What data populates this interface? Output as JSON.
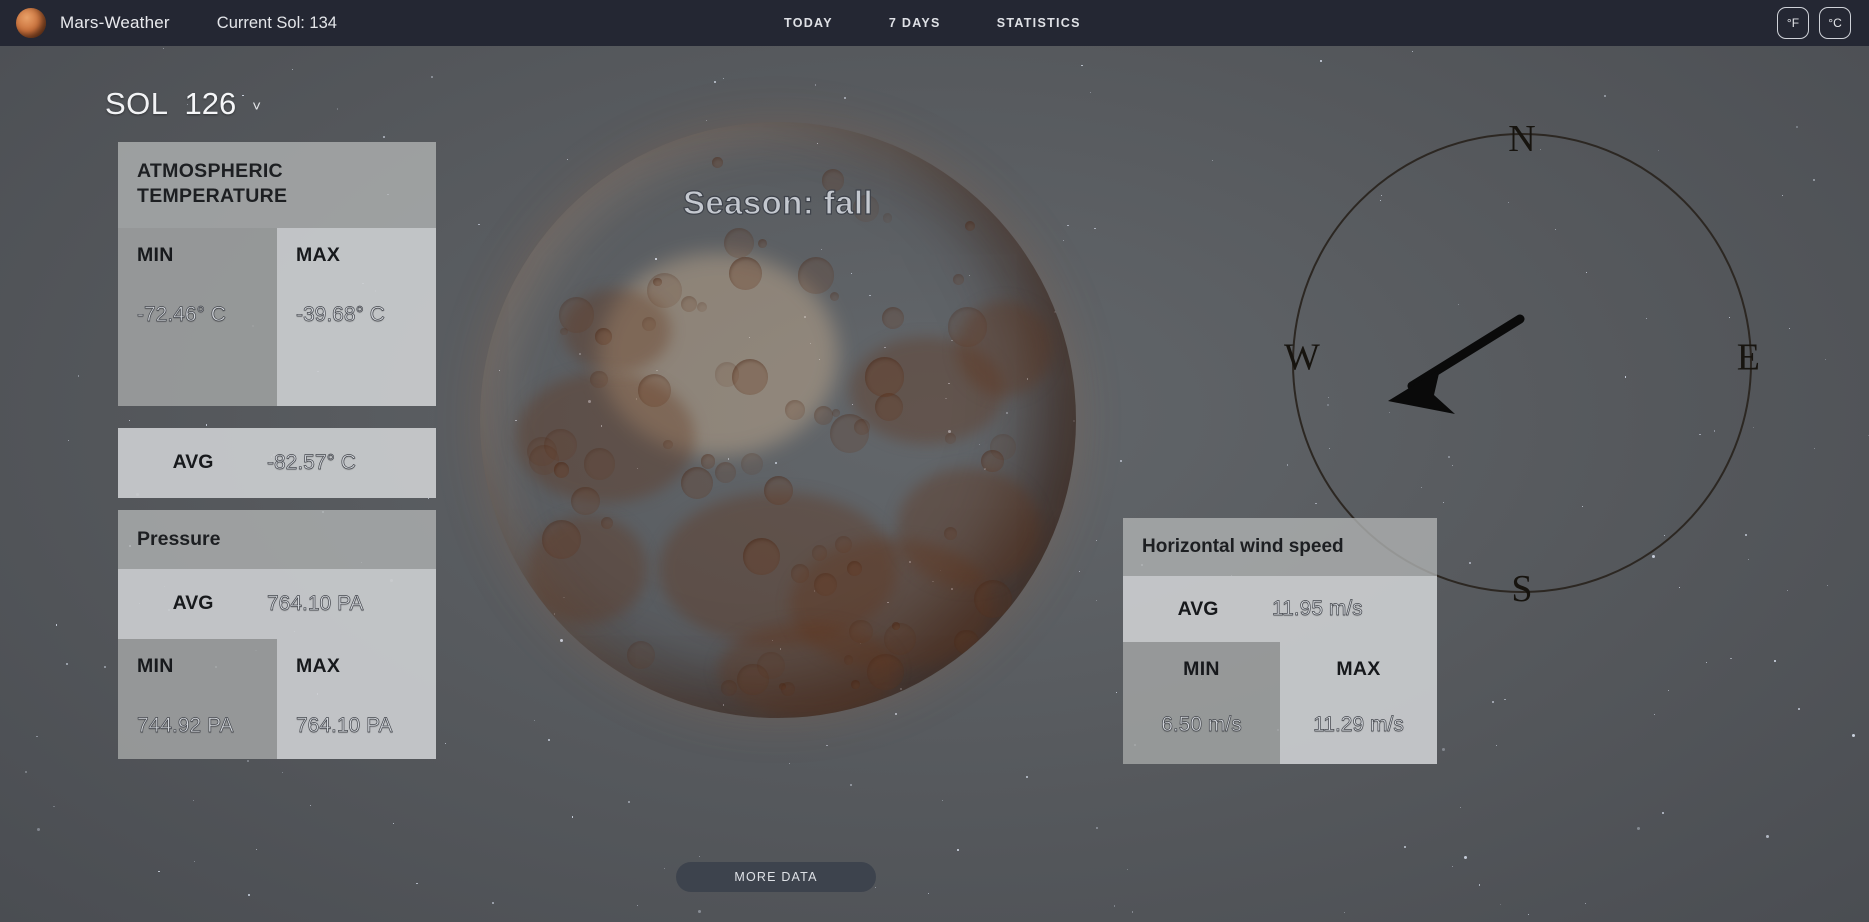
{
  "header": {
    "brand_name": "Mars-Weather",
    "brand_logo_icon": "mars-planet-icon",
    "current_sol": "Current Sol: 134",
    "nav": [
      {
        "label": "TODAY"
      },
      {
        "label": "7 DAYS"
      },
      {
        "label": "STATISTICS"
      }
    ],
    "units": [
      {
        "label": "°F"
      },
      {
        "label": "°C"
      }
    ]
  },
  "sol_selector": {
    "label": "SOL",
    "value": "126",
    "caret_icon": "chevron-down-icon"
  },
  "temperature_card": {
    "title": "ATMOSPHERIC TEMPERATURE",
    "min_label": "MIN",
    "min_value": "-72.46° C",
    "max_label": "MAX",
    "max_value": "-39.68° C",
    "avg_label": "AVG",
    "avg_value": "-82.57° C"
  },
  "pressure_card": {
    "title": "Pressure",
    "avg_label": "AVG",
    "avg_value": "764.10 PA",
    "min_label": "MIN",
    "min_value": "744.92 PA",
    "max_label": "MAX",
    "max_value": "764.10 PA"
  },
  "wind_card": {
    "title": "Horizontal wind speed",
    "avg_label": "AVG",
    "avg_value": "11.95 m/s",
    "min_label": "MIN",
    "min_value": "6.50 m/s",
    "max_label": "MAX",
    "max_value": "11.29 m/s"
  },
  "compass": {
    "north": "N",
    "east": "E",
    "south": "S",
    "west": "W",
    "arrow_icon": "wind-direction-arrow-icon"
  },
  "planet": {
    "season_text": "Season: fall",
    "planet_icon": "mars-globe-icon"
  },
  "more_data_button": {
    "label": "MORE DATA"
  },
  "colors": {
    "header_bg": "#242733",
    "page_bg": "#5a5e61",
    "panel_dark": "#9ea1a1",
    "panel_light": "#cdcfd1",
    "mars_orange": "#d2854f",
    "text_dark": "#17191c",
    "value_text": "#d5d8dd",
    "button_bg": "#3d434d"
  }
}
